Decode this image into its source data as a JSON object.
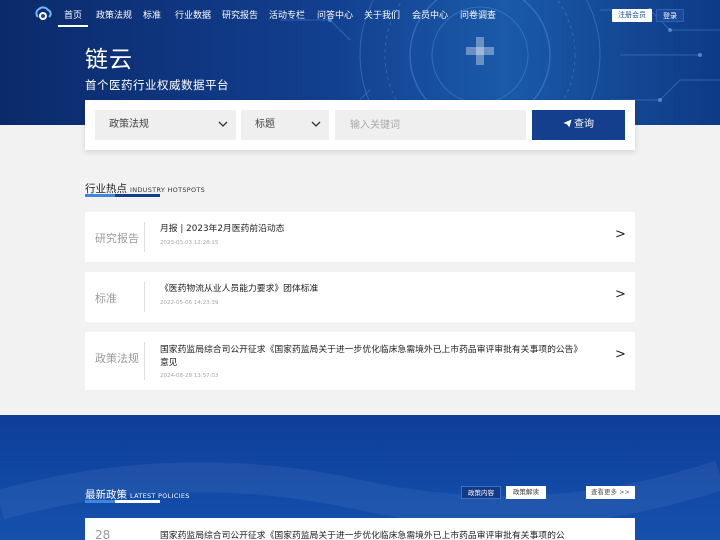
{
  "nav": {
    "items": [
      {
        "label": "首页",
        "active": true
      },
      {
        "label": "政策法规"
      },
      {
        "label": "标准"
      },
      {
        "label": "行业数据"
      },
      {
        "label": "研究报告"
      },
      {
        "label": "活动专栏"
      },
      {
        "label": "问答中心"
      },
      {
        "label": "关于我们"
      },
      {
        "label": "会员中心"
      },
      {
        "label": "问卷调查"
      }
    ],
    "register_label": "注册会员",
    "login_label": "登录"
  },
  "hero": {
    "brand": "链云",
    "slogan": "首个医药行业权威数据平台"
  },
  "search": {
    "category_value": "政策法规",
    "field_value": "标题",
    "keyword_placeholder": "输入关键词",
    "query_label": "查询"
  },
  "hotspots": {
    "title": "行业热点",
    "subtitle": "INDUSTRY HOTSPOTS",
    "items": [
      {
        "category": "研究报告",
        "title": "月报 | 2023年2月医药前沿动态",
        "date": "2023-03-03 12:28:15"
      },
      {
        "category": "标准",
        "title": "《医药物流从业人员能力要求》团体标准",
        "date": "2022-05-06 14:23:39"
      },
      {
        "category": "政策法规",
        "title": "国家药监局综合司公开征求《国家药监局关于进一步优化临床急需境外已上市药品审评审批有关事项的公告》意见",
        "date": "2024-08-28 13:57:03"
      }
    ]
  },
  "policies": {
    "title": "最新政策",
    "subtitle": "LATEST POLICIES",
    "tab_content": "政策内容",
    "tab_interpret": "政策解读",
    "more_label": "查看更多 >>",
    "items": [
      {
        "day": "28",
        "title": "国家药监局综合司公开征求《国家药监局关于进一步优化临床急需境外已上市药品审评审批有关事项的公"
      }
    ]
  },
  "colors": {
    "primary": "#133f8c",
    "accent_light": "#3f86e0",
    "page_bg": "#f2f2f2"
  },
  "icons": {
    "logo": "cloud-logo-icon",
    "dropdown": "chevron-down-icon",
    "query": "paper-plane-icon",
    "card_arrow": "chevron-right-icon"
  }
}
